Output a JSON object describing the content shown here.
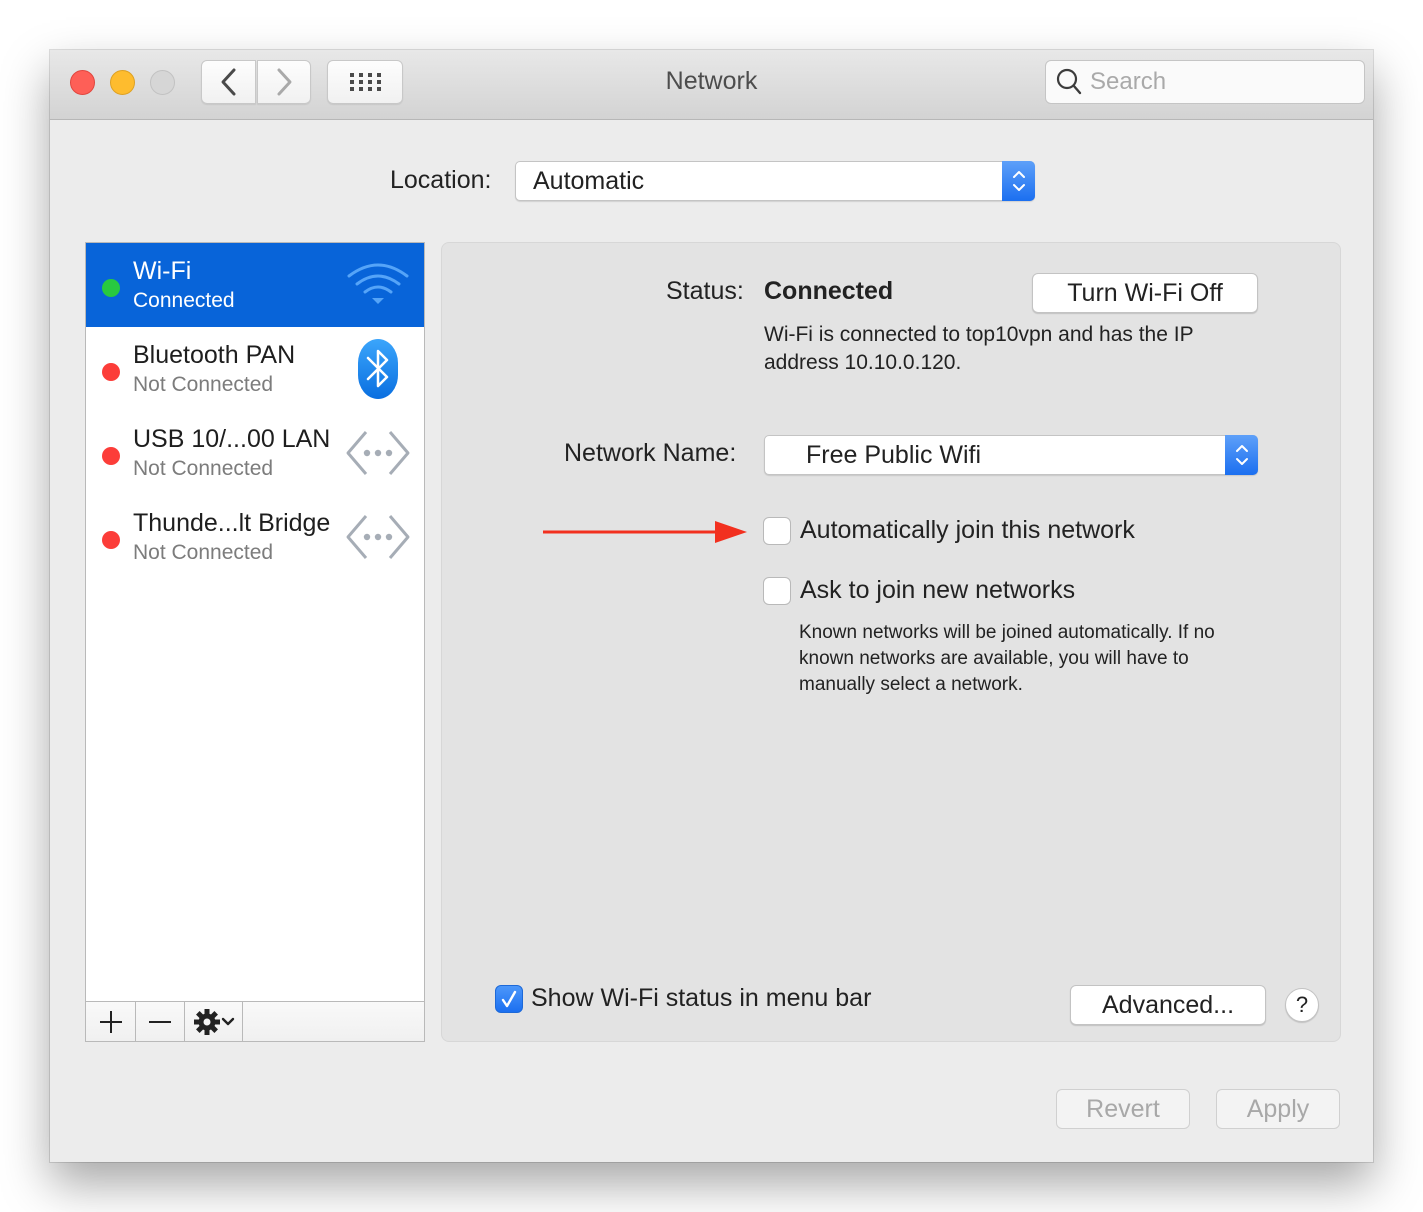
{
  "window": {
    "title": "Network",
    "search": {
      "placeholder": "Search",
      "value": ""
    }
  },
  "location": {
    "label": "Location:",
    "selected": "Automatic"
  },
  "services": [
    {
      "name": "Wi-Fi",
      "status": "Connected",
      "status_color": "#28c940",
      "icon": "wifi-icon",
      "selected": true
    },
    {
      "name": "Bluetooth PAN",
      "status": "Not Connected",
      "status_color": "#fc3d39",
      "icon": "bluetooth-icon",
      "selected": false
    },
    {
      "name": "USB 10/...00 LAN",
      "status": "Not Connected",
      "status_color": "#fc3d39",
      "icon": "ethernet-icon",
      "selected": false
    },
    {
      "name": "Thunde...lt Bridge",
      "status": "Not Connected",
      "status_color": "#fc3d39",
      "icon": "ethernet-icon",
      "selected": false
    }
  ],
  "sidebar_toolbar": {
    "add": "+",
    "remove": "—"
  },
  "detail": {
    "status_label": "Status:",
    "status_value": "Connected",
    "turn_off_button": "Turn Wi-Fi Off",
    "status_description": "Wi-Fi is connected to top10vpn and has the IP address 10.10.0.120.",
    "network_name_label": "Network Name:",
    "network_name": "Free Public Wifi",
    "auto_join": {
      "label": "Automatically join this network",
      "checked": false
    },
    "ask_join": {
      "label": "Ask to join new networks",
      "checked": false
    },
    "ask_description": "Known networks will be joined automatically. If no known networks are available, you will have to manually select a network.",
    "show_menu_status": {
      "label": "Show Wi-Fi status in menu bar",
      "checked": true
    },
    "advanced_button": "Advanced...",
    "help_button": "?"
  },
  "footer": {
    "revert_button": "Revert",
    "apply_button": "Apply"
  },
  "colors": {
    "accent": "#0864d9",
    "annotation_arrow": "#f2301f"
  }
}
